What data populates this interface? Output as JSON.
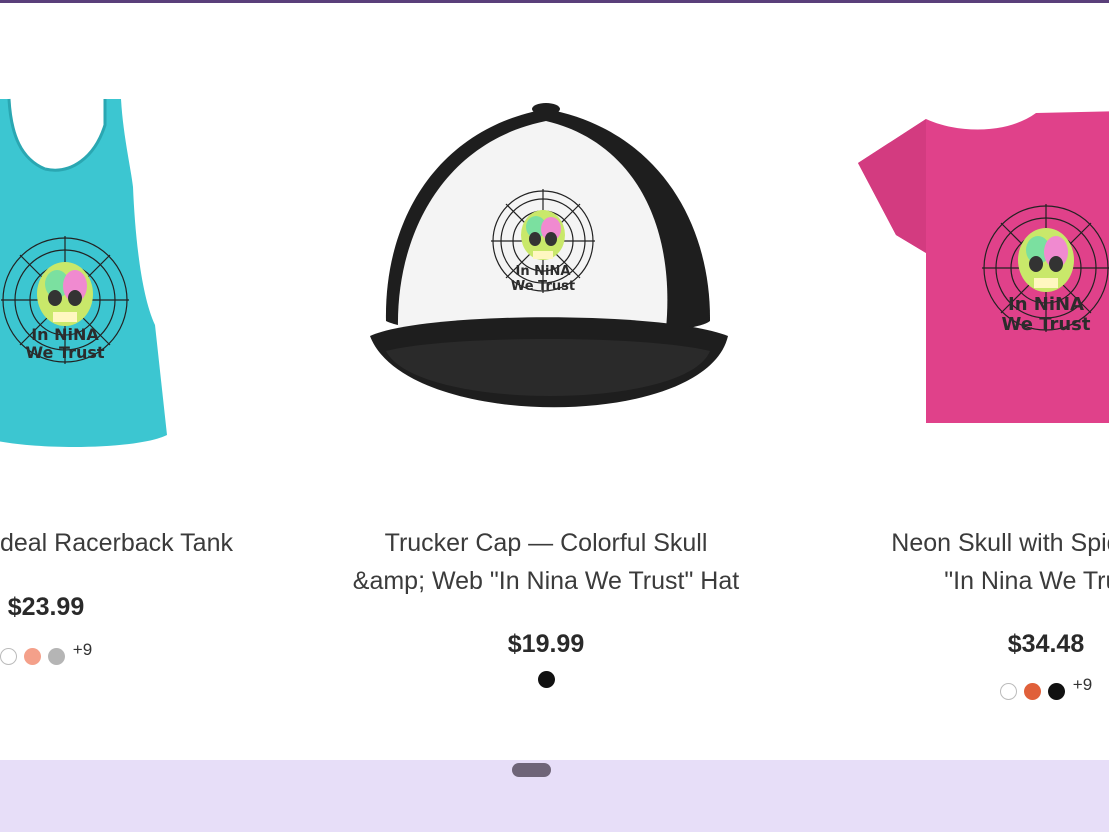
{
  "products": [
    {
      "title_lines": [
        "Ideal Racerback Tank",
        ""
      ],
      "price": "$23.99",
      "swatches": [
        "#ffffff",
        "#f4a08a",
        "#b5b5b5"
      ],
      "more": "+9"
    },
    {
      "title_lines": [
        "Trucker Cap — Colorful Skull",
        "&amp; Web \"In Nina We Trust\" Hat"
      ],
      "price": "$19.99",
      "swatches": [
        "#111111"
      ],
      "more": ""
    },
    {
      "title_lines": [
        "Neon Skull with Spider Web",
        "\"In Nina We Trust\""
      ],
      "price": "$34.48",
      "swatches": [
        "#ffffff",
        "#e0603a",
        "#111111"
      ],
      "more": "+9"
    }
  ],
  "graphic_text": [
    "In NiNA",
    "We Trust"
  ],
  "colors": {
    "tank": "#3cc6d1",
    "tee": "#e0418a",
    "cap_front": "#f4f4f4",
    "cap_dark": "#1e1e1e",
    "footer": "#e7def8"
  }
}
